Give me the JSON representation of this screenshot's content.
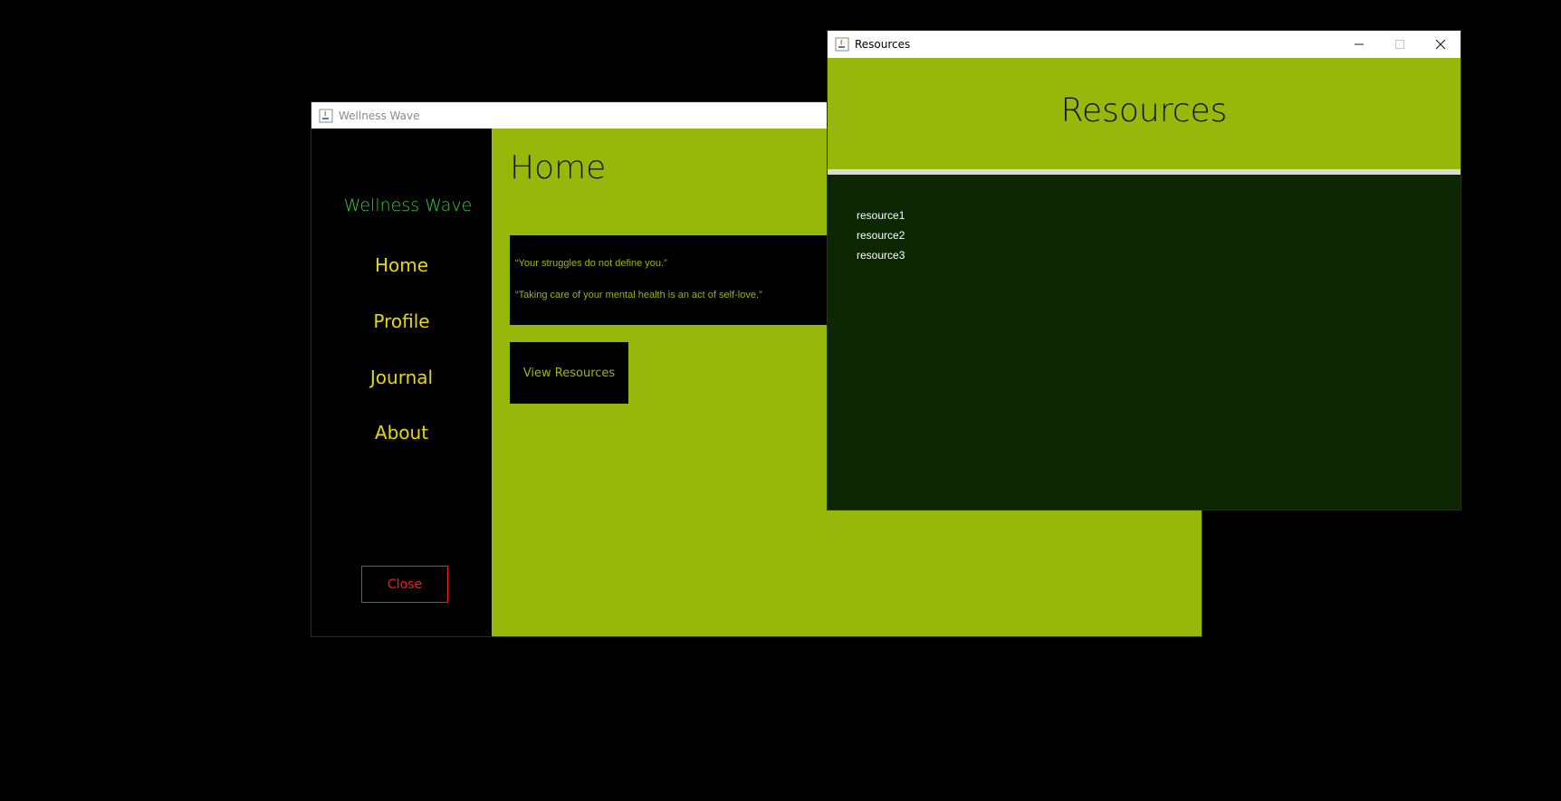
{
  "main_window": {
    "title": "Wellness Wave",
    "sidebar": {
      "brand": "Wellness Wave",
      "items": [
        {
          "label": "Home"
        },
        {
          "label": "Profile"
        },
        {
          "label": "Journal"
        },
        {
          "label": "About"
        }
      ],
      "close_label": "Close"
    },
    "content": {
      "title": "Home",
      "quotes": [
        "“Your struggles do not define you.”",
        "“Taking care of your mental health is an act of self-love.”"
      ],
      "view_resources_label": "View Resources"
    }
  },
  "resources_window": {
    "title": "Resources",
    "heading": "Resources",
    "items": [
      "resource1",
      "resource2",
      "resource3"
    ],
    "controls": {
      "minimize": "minimize-icon",
      "maximize": "maximize-icon",
      "close": "close-icon"
    }
  },
  "colors": {
    "accent_green": "#98b70b",
    "nav_yellow": "#e8d900",
    "brand_green": "#33cc33",
    "close_red": "#ff1a1a",
    "resources_bg": "#0b2601"
  }
}
